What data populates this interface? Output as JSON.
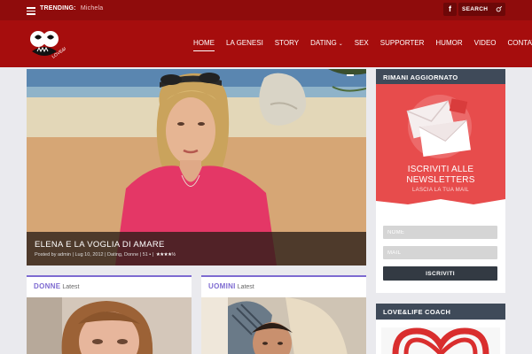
{
  "topbar": {
    "trending_label": "TRENDING:",
    "trending_value": "Michela",
    "facebook_glyph": "f",
    "search_placeholder": "SEARCH"
  },
  "header": {
    "logo_text": "LOVE&LIFE",
    "nav": [
      {
        "label": "HOME",
        "active": true
      },
      {
        "label": "LA GENESI"
      },
      {
        "label": "STORY"
      },
      {
        "label": "DATING",
        "has_submenu": true
      },
      {
        "label": "SEX"
      },
      {
        "label": "SUPPORTER"
      },
      {
        "label": "HUMOR"
      },
      {
        "label": "VIDEO"
      },
      {
        "label": "CONTATTI"
      }
    ]
  },
  "hero": {
    "title": "ELENA E LA VOGLIA DI AMARE",
    "meta": "Posted by admin | Lug 10, 2012 | Dating, Donne | 51",
    "rating_stars": "★★★★½"
  },
  "categories": [
    {
      "name": "DONNE",
      "sub": "Latest"
    },
    {
      "name": "UOMINI",
      "sub": "Latest"
    }
  ],
  "sidebar": {
    "newsletter_header": "RIMANI AGGIORNATO",
    "newsletter_title_line1": "ISCRIVITI ALLE",
    "newsletter_title_line2": "NEWSLETTERS",
    "newsletter_sub": "LASCIA LA TUA MAIL",
    "name_placeholder": "NOME",
    "mail_placeholder": "MAIL",
    "subscribe_label": "ISCRIVITI",
    "coach_header": "LOVE&LIFE COACH"
  },
  "colors": {
    "topbar": "#8f0c0c",
    "header": "#a60d0d",
    "accent_purple": "#7e6bd1",
    "newsletter_red": "#e74c4c",
    "sidebar_head": "#3f4a59"
  }
}
